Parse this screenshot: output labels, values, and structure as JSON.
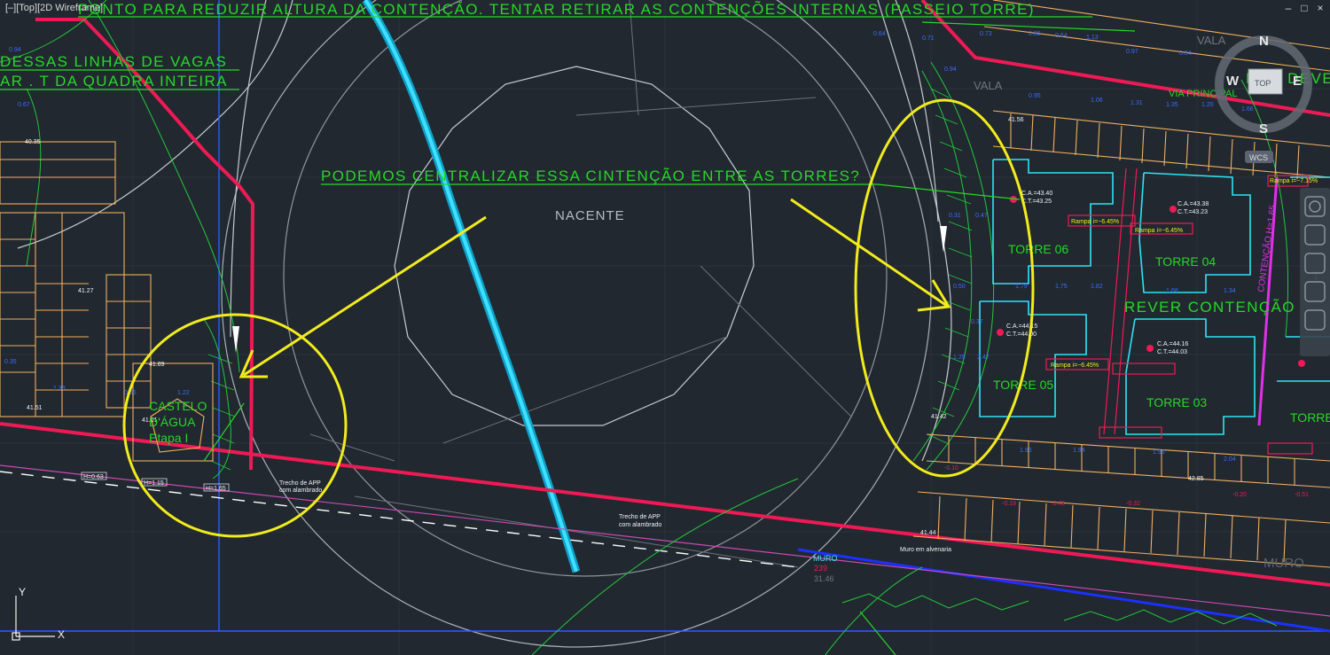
{
  "viewport": {
    "title": "[–][Top][2D Wireframe]",
    "window_controls": {
      "minimize": "–",
      "restore": "□",
      "close": "×"
    }
  },
  "colors": {
    "background": "#212830",
    "annotation_green": "#27d827",
    "markup_yellow": "#f2ec1c",
    "boundary_red": "#ef1a55",
    "stream_cyan": "#19c9f5",
    "building_cyan": "#2fe3f5",
    "lot_orange": "#f0b060"
  },
  "annotations": {
    "top_note": "PONTO PARA REDUZIR ALTURA DA CONTENÇÃO. TENTAR RETIRAR AS CONTENÇÕES INTERNAS (PASSEIO TORRE)",
    "left_note_1": "DESSAS LINHAS DE VAGAS",
    "left_note_2": "AR . T DA QUADRA INTEIRA",
    "center_note": "PODEMOS CENTRALIZAR ESSA CINTENÇÃO ENTRE AS TORRES?",
    "rever": "REVER CONTENÇÃO",
    "nao_dever": "NÃO DEVER"
  },
  "labels": {
    "nacente": "NACENTE",
    "torre_06": "TORRE 06",
    "torre_04": "TORRE 04",
    "torre_05": "TORRE 05",
    "torre_03": "TORRE 03",
    "torre_cut": "TORRE",
    "castelo_1": "CASTELO",
    "castelo_2": "D'ÁGUA",
    "castelo_3": "Etapa I",
    "vala_1": "VALA",
    "vala_2": "VALA",
    "via_principal": "VIA PRINCIPAL",
    "muro": "MURO",
    "muro_value": "239",
    "muro_level": "31.46",
    "muro_alv": "Muro em alvenaria",
    "muro_right": "MURO",
    "trecho_1": "Trecho de APP",
    "trecho_1b": "com alambrado",
    "trecho_2": "Trecho de APP",
    "trecho_2b": "com alambrado",
    "conteudo": "CONTENÇÃO H=1.65",
    "elev_1": "41.56",
    "elev_2": "41.89",
    "elev_3": "41.01",
    "elev_4": "41.51",
    "elev_5": "41.27",
    "elev_6": "41.42",
    "elev_7": "41.44",
    "elev_8": "42.85",
    "elev_9": "40.35",
    "rampa_1": "Rampa i=−6.45%",
    "rampa_2": "Rampa i=−6.45%",
    "rampa_3": "Rampa i=−6.45%",
    "rampa_4": "Rampa i=−7.15%",
    "ca_1": "C.A.=43.40",
    "ca_2": "C.T.=43.25",
    "ca_3": "C.A.=43.38",
    "ca_4": "C.T.=43.23",
    "ca_5": "C.A.=44.15",
    "ca_6": "C.T.=44.00",
    "ca_7": "C.A.=44.16",
    "ca_8": "C.T.=44.03",
    "h_1": "H=0.63",
    "h_2": "H=1.15",
    "h_3": "H=1.65",
    "red_1": "-0.10",
    "red_2": "-0.43",
    "red_3": "-0.32",
    "red_4": "-0.19"
  },
  "compass": {
    "north": "N",
    "south": "S",
    "east": "E",
    "west": "W",
    "top_button": "TOP",
    "wcs": "WCS"
  },
  "ucs": {
    "x": "X",
    "y": "Y"
  },
  "icons": [
    "ucs-icon",
    "viewcube-icon",
    "nav-bar-icon"
  ]
}
